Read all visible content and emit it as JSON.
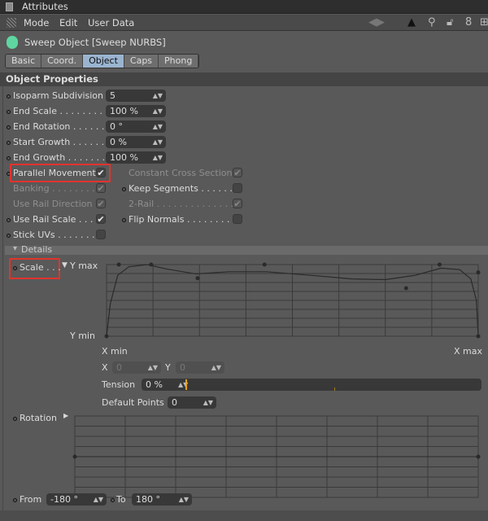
{
  "window": {
    "title": "Attributes"
  },
  "menu": {
    "items": [
      "Mode",
      "Edit",
      "User Data"
    ],
    "tool_icons": [
      "nav-arrows-icon",
      "pointer-up-icon",
      "search-icon",
      "lock-icon",
      "chain-icon",
      "new-panel-icon"
    ]
  },
  "object": {
    "title": "Sweep Object [Sweep NURBS]",
    "icon": "sweep-nurbs-icon",
    "icon_color": "#5fd6a0"
  },
  "tabs": [
    {
      "label": "Basic"
    },
    {
      "label": "Coord."
    },
    {
      "label": "Object",
      "active": true
    },
    {
      "label": "Caps"
    },
    {
      "label": "Phong"
    }
  ],
  "section": {
    "title": "Object Properties"
  },
  "fields": [
    {
      "label": "Isoparm Subdivision",
      "value": "5"
    },
    {
      "label": "End Scale . . . . . . . . .",
      "value": "100 %"
    },
    {
      "label": "End Rotation . . . . . .",
      "value": "0 °"
    },
    {
      "label": "Start Growth . . . . . .",
      "value": "0 %"
    },
    {
      "label": "End Growth . . . . . . .",
      "value": "100 %"
    }
  ],
  "checks_left": [
    {
      "label": "Parallel Movement",
      "checked": true,
      "enabled": true,
      "highlighted": true
    },
    {
      "label": "Banking . . . . . . . . .",
      "checked": true,
      "enabled": false
    },
    {
      "label": "Use Rail Direction",
      "checked": true,
      "enabled": false
    },
    {
      "label": "Use Rail Scale . . . .",
      "checked": true,
      "enabled": true
    },
    {
      "label": "Stick UVs . . . . . . . .",
      "checked": false,
      "enabled": true
    }
  ],
  "checks_right": [
    {
      "label": "Constant Cross Section",
      "checked": true,
      "enabled": false
    },
    {
      "label": "Keep Segments . . . . . . .",
      "checked": false,
      "enabled": true
    },
    {
      "label": "2-Rail . . . . . . . . . . . . . . .",
      "checked": true,
      "enabled": false
    },
    {
      "label": "Flip Normals . . . . . . . . .",
      "checked": false,
      "enabled": true
    }
  ],
  "details": {
    "title": "Details",
    "scale": {
      "label": "Scale . . .",
      "y_max": "Y max",
      "y_min": "Y min",
      "x_min": "X min",
      "x_max": "X max",
      "spline_points": [
        [
          0,
          0
        ],
        [
          0.033,
          1
        ],
        [
          0.12,
          1
        ],
        [
          0.245,
          0.81
        ],
        [
          0.425,
          1
        ],
        [
          0.806,
          0.67
        ],
        [
          0.896,
          1
        ],
        [
          1,
          0.89
        ],
        [
          1,
          0
        ]
      ]
    },
    "x_label": "X",
    "x_value": "0",
    "y_label": "Y",
    "y_value": "0",
    "tension": {
      "label": "Tension",
      "value": "0 %",
      "accent": "#e8a020"
    },
    "default_points": {
      "label": "Default Points",
      "value": "0"
    },
    "rotation": {
      "label": "Rotation",
      "spline_points": [
        [
          0,
          0.5
        ],
        [
          1,
          0.5
        ]
      ]
    },
    "from": {
      "label": "From",
      "value": "-180 °"
    },
    "to": {
      "label": "To",
      "value": "180 °"
    }
  }
}
